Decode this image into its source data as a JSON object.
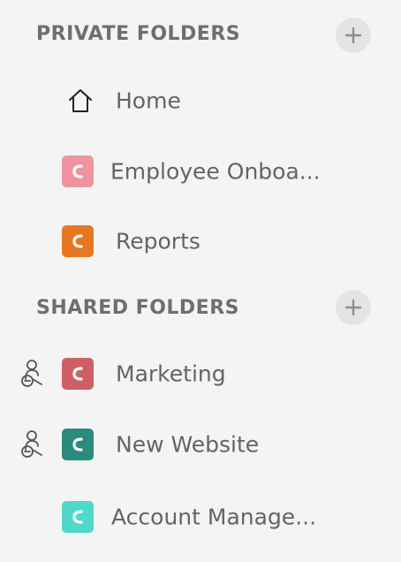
{
  "private_section": {
    "title": "PRIVATE FOLDERS",
    "add_icon": "plus-icon"
  },
  "private_items": [
    {
      "label": "Home",
      "icon": "home-icon"
    },
    {
      "label": "Employee Onboa...",
      "icon": "folder-icon",
      "color": "#ef949f"
    },
    {
      "label": "Reports",
      "icon": "folder-icon",
      "color": "#e87722"
    }
  ],
  "shared_section": {
    "title": "SHARED FOLDERS",
    "add_icon": "plus-icon"
  },
  "shared_items": [
    {
      "label": "Marketing",
      "icon": "folder-icon",
      "color": "#cf5f66",
      "shared_icon": "shared-users-icon"
    },
    {
      "label": "New Website",
      "icon": "folder-icon",
      "color": "#2b8a7e",
      "shared_icon": "shared-users-icon"
    },
    {
      "label": "Account Manage...",
      "icon": "folder-icon",
      "color": "#4fd9c8"
    }
  ]
}
